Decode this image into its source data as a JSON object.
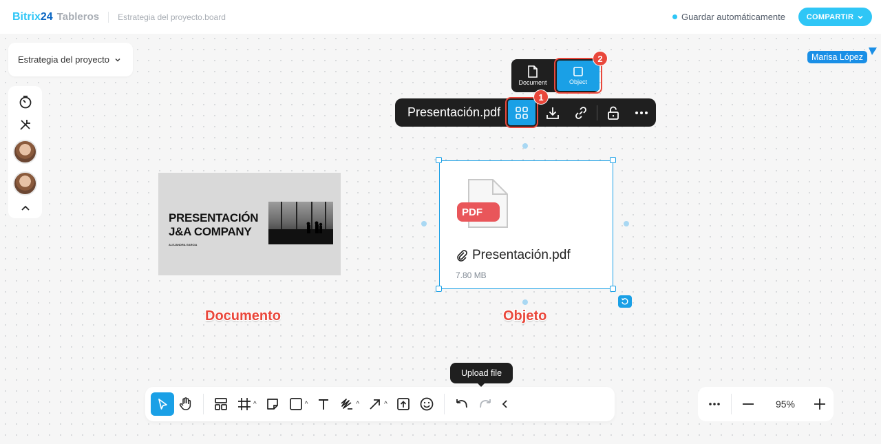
{
  "header": {
    "brand_name": "Bitrix",
    "brand_number": "24",
    "product": "Tableros",
    "file_title": "Estrategia del proyecto.board",
    "autosave": "Guardar automáticamente",
    "share_label": "COMPARTIR"
  },
  "board_select": {
    "label": "Estrategia del proyecto"
  },
  "collaborator": {
    "name": "Marisa López"
  },
  "slide": {
    "title_line1": "PRESENTACIÓN",
    "title_line2": "J&A COMPANY",
    "author": "ALEJANDRA GARCIA"
  },
  "labels": {
    "document": "Documento",
    "object": "Objeto"
  },
  "object_card": {
    "file_badge": "PDF",
    "name": "Presentación.pdf",
    "size": "7.80 MB"
  },
  "context_bar": {
    "file_name": "Presentación.pdf"
  },
  "view_popup": {
    "document_label": "Document",
    "object_label": "Object"
  },
  "badges": {
    "one": "1",
    "two": "2"
  },
  "tooltip": {
    "text": "Upload file"
  },
  "zoom": {
    "value": "95%"
  },
  "colors": {
    "accent": "#1aa0e6",
    "brand": "#2fc6f6",
    "highlight": "#e9473b"
  }
}
